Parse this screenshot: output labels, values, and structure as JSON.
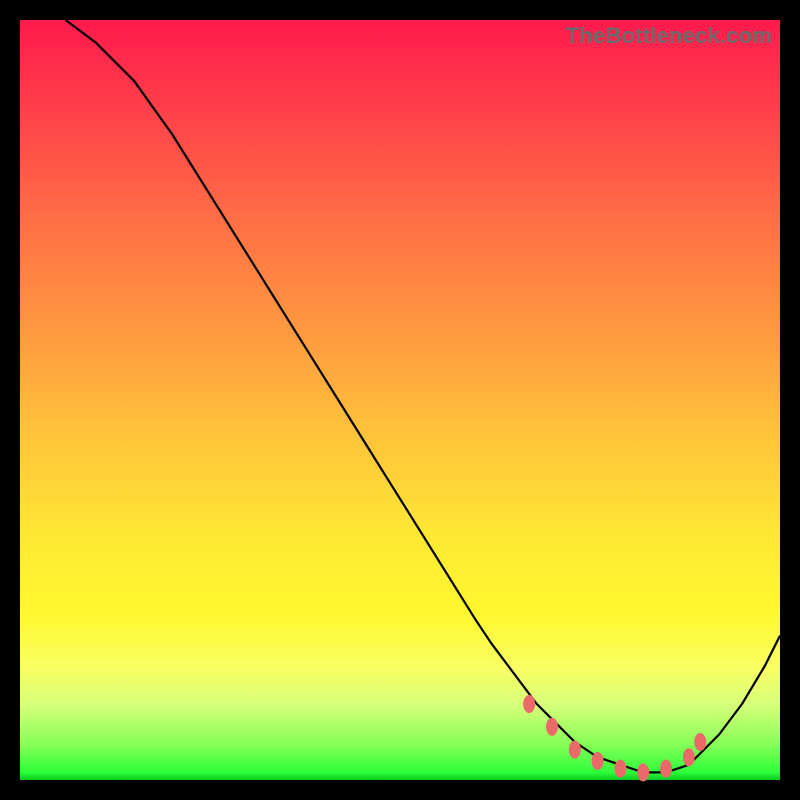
{
  "watermark": "TheBottleneck.com",
  "colors": {
    "gradient_top": "#ff1a4d",
    "gradient_mid": "#ffe834",
    "gradient_bottom": "#08c820",
    "line": "#000000",
    "dots": "#ea6a6a",
    "frame": "#000000"
  },
  "chart_data": {
    "type": "line",
    "title": "",
    "xlabel": "",
    "ylabel": "",
    "xlim": [
      0,
      100
    ],
    "ylim": [
      0,
      100
    ],
    "x": [
      6,
      10,
      15,
      20,
      25,
      30,
      35,
      40,
      45,
      50,
      55,
      60,
      62,
      65,
      68,
      70,
      73,
      76,
      79,
      82,
      85,
      88,
      90,
      92,
      95,
      98,
      100
    ],
    "y": [
      100,
      97,
      92,
      85,
      77,
      69,
      61,
      53,
      45,
      37,
      29,
      21,
      18,
      14,
      10,
      8,
      5,
      3,
      2,
      1,
      1,
      2,
      4,
      6,
      10,
      15,
      19
    ],
    "markers": {
      "x": [
        67,
        70,
        73,
        76,
        79,
        82,
        85,
        88,
        89.5
      ],
      "y": [
        10,
        7,
        4,
        2.5,
        1.5,
        1,
        1.5,
        3,
        5
      ]
    },
    "annotations": []
  }
}
